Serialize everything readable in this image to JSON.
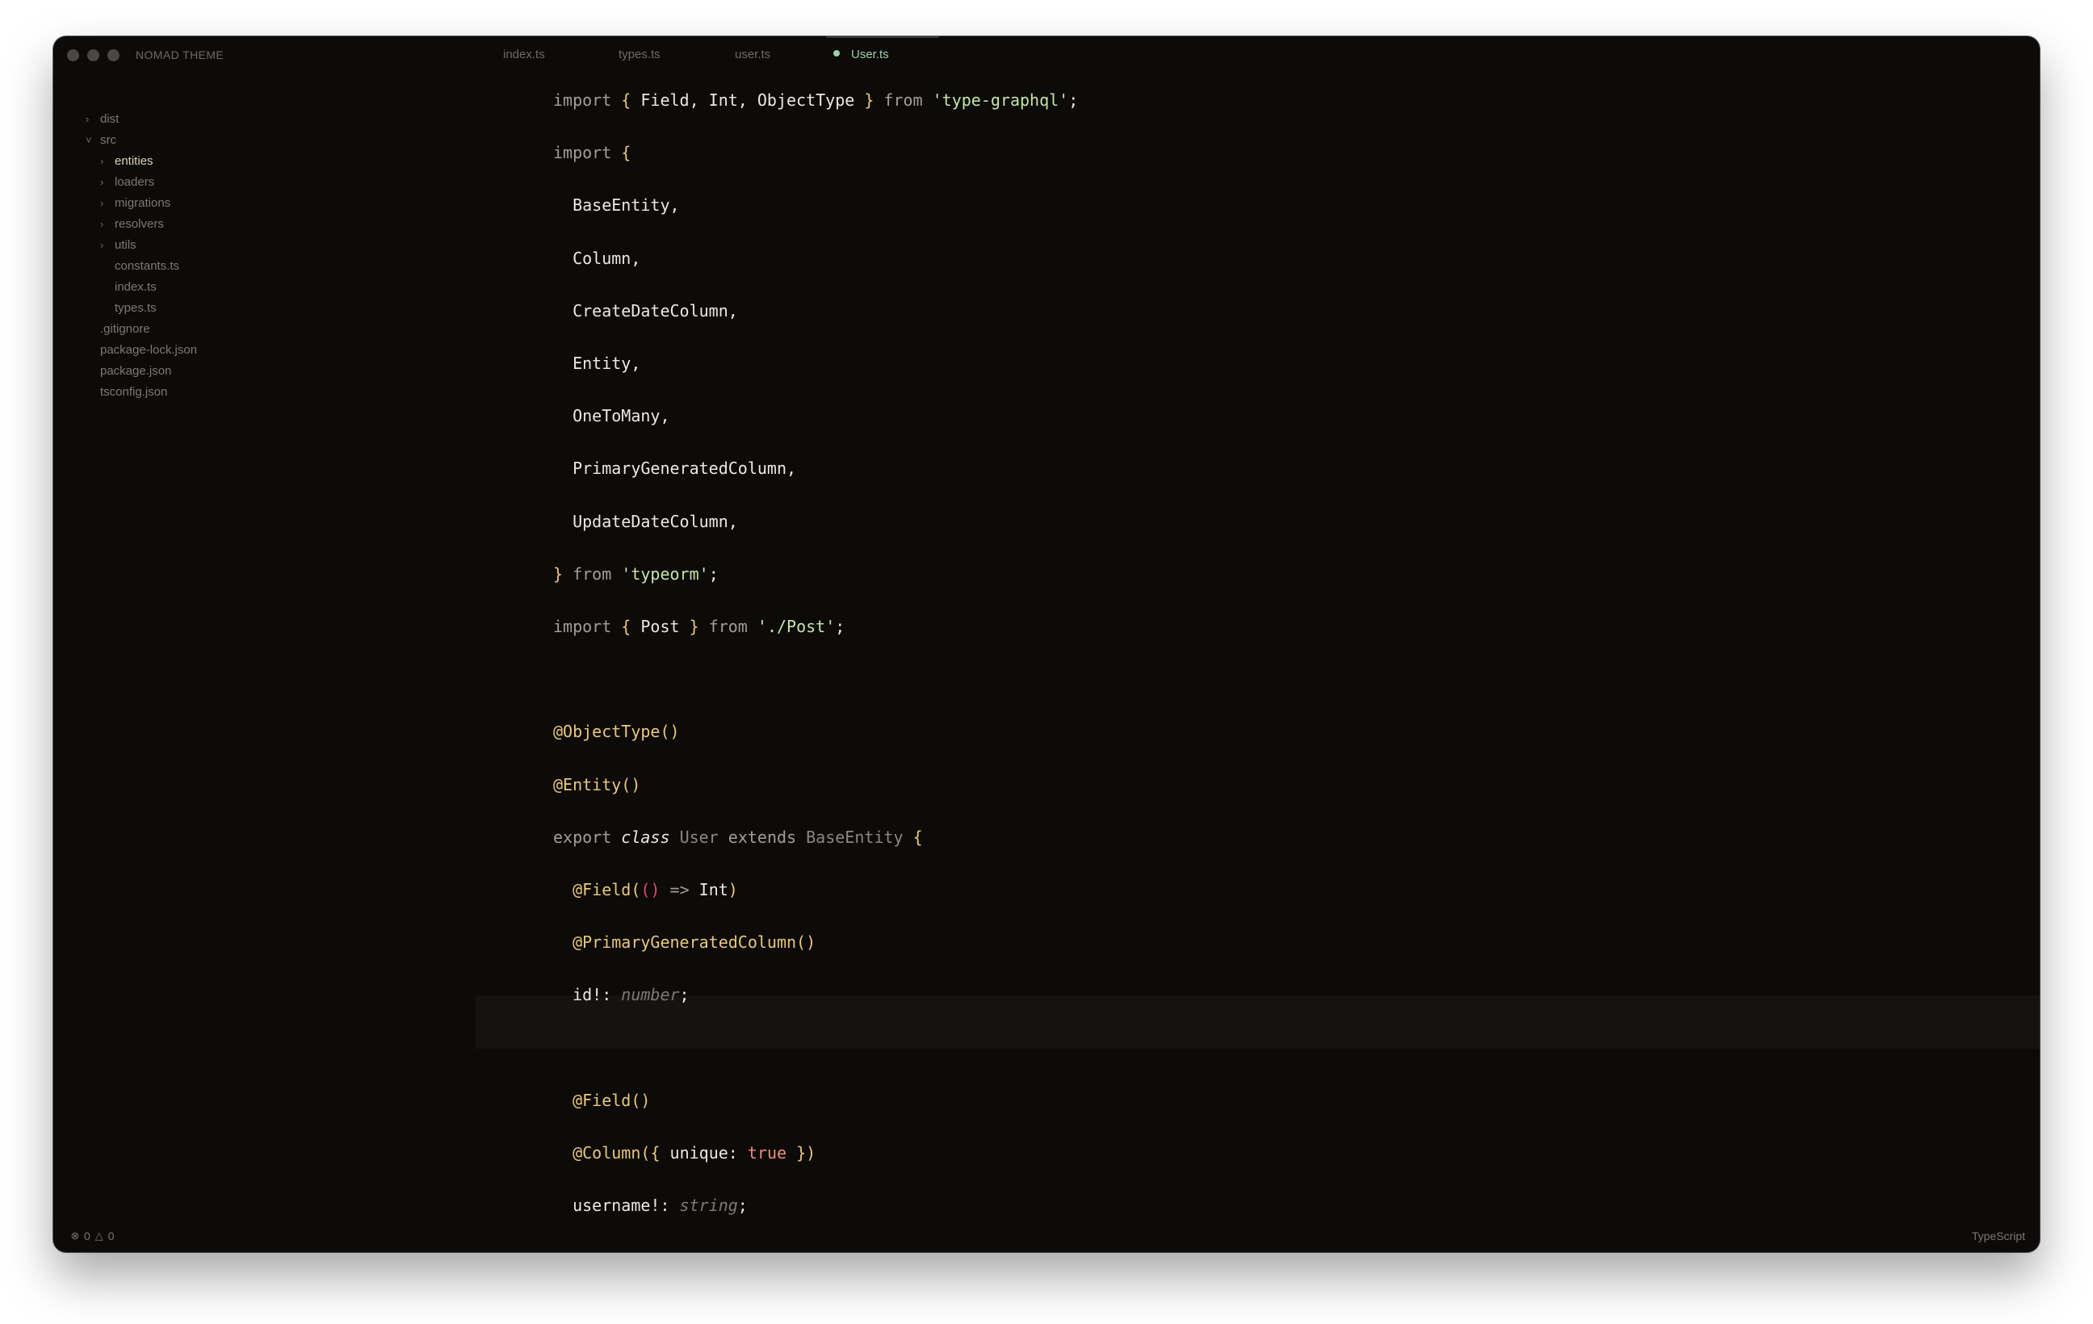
{
  "titlebar": {
    "app_title": "NOMAD THEME"
  },
  "tabs": [
    {
      "label": "index.ts",
      "active": false
    },
    {
      "label": "types.ts",
      "active": false
    },
    {
      "label": "user.ts",
      "active": false
    },
    {
      "label": "User.ts",
      "active": true,
      "modified": true
    }
  ],
  "sidebar": {
    "items": [
      {
        "label": "dist",
        "type": "folder",
        "expanded": false,
        "depth": 0
      },
      {
        "label": "src",
        "type": "folder",
        "expanded": true,
        "depth": 0
      },
      {
        "label": "entities",
        "type": "folder",
        "expanded": false,
        "depth": 1,
        "highlight": true
      },
      {
        "label": "loaders",
        "type": "folder",
        "expanded": false,
        "depth": 1
      },
      {
        "label": "migrations",
        "type": "folder",
        "expanded": false,
        "depth": 1
      },
      {
        "label": "resolvers",
        "type": "folder",
        "expanded": false,
        "depth": 1
      },
      {
        "label": "utils",
        "type": "folder",
        "expanded": false,
        "depth": 1
      },
      {
        "label": "constants.ts",
        "type": "file",
        "depth": 1
      },
      {
        "label": "index.ts",
        "type": "file",
        "depth": 1
      },
      {
        "label": "types.ts",
        "type": "file",
        "depth": 1
      },
      {
        "label": ".gitignore",
        "type": "file",
        "depth": 0
      },
      {
        "label": "package-lock.json",
        "type": "file",
        "depth": 0
      },
      {
        "label": "package.json",
        "type": "file",
        "depth": 0
      },
      {
        "label": "tsconfig.json",
        "type": "file",
        "depth": 0
      }
    ]
  },
  "editor": {
    "lines": [
      "import { Field, Int, ObjectType } from 'type-graphql';",
      "import {",
      "  BaseEntity,",
      "  Column,",
      "  CreateDateColumn,",
      "  Entity,",
      "  OneToMany,",
      "  PrimaryGeneratedColumn,",
      "  UpdateDateColumn,",
      "} from 'typeorm';",
      "import { Post } from './Post';",
      "",
      "@ObjectType()",
      "@Entity()",
      "export class User extends BaseEntity {",
      "  @Field(() => Int)",
      "  @PrimaryGeneratedColumn()",
      "  id!: number;",
      "",
      "  @Field()",
      "  @Column({ unique: true })",
      "  username!: string;"
    ],
    "highlighted_line": 18
  },
  "statusbar": {
    "errors": "0",
    "warnings": "0",
    "language": "TypeScript"
  },
  "colors": {
    "background": "#0d0a0a",
    "string": "#c5e6a5",
    "decorator": "#e9c87a",
    "keyword": "#a39d9a",
    "boolean": "#f08d76",
    "active_tab": "#9ecfa6"
  }
}
